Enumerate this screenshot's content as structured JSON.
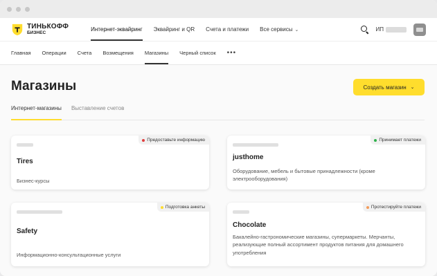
{
  "titlebar": {
    "dots": 3
  },
  "logo": {
    "line1": "ТИНЬКОФФ",
    "line2": "БИЗНЕС"
  },
  "topnav": {
    "items": [
      {
        "label": "Интернет-эквайринг",
        "active": true
      },
      {
        "label": "Эквайринг и QR",
        "active": false
      },
      {
        "label": "Счета и платежи",
        "active": false
      },
      {
        "label": "Все сервисы",
        "active": false
      }
    ],
    "user_prefix": "ИП"
  },
  "subnav": {
    "items": [
      {
        "label": "Главная",
        "active": false
      },
      {
        "label": "Операции",
        "active": false
      },
      {
        "label": "Счета",
        "active": false
      },
      {
        "label": "Возмещения",
        "active": false
      },
      {
        "label": "Магазины",
        "active": true
      },
      {
        "label": "Черный список",
        "active": false
      }
    ],
    "more_label": "•••"
  },
  "page": {
    "title": "Магазины",
    "create_button": "Создать магазин"
  },
  "tabs": [
    {
      "label": "Интернет-магазины",
      "active": true
    },
    {
      "label": "Выставление счетов",
      "active": false
    }
  ],
  "stores": [
    {
      "name": "Tires",
      "description": "Бизнес-курсы",
      "status": "Предоставьте информацию",
      "status_color": "#e03e3e"
    },
    {
      "name": "justhome",
      "description": "Оборудование, мебель и бытовые принадлежности (кроме электрооборудования)",
      "status": "Принимает платежи",
      "status_color": "#2fb24c"
    },
    {
      "name": "Safety",
      "description": "Информационно-консультационные услуги",
      "status": "Подготовка анкеты",
      "status_color": "#ffdd2d"
    },
    {
      "name": "Chocolate",
      "description": "Бакалейно-гастрономические магазины, супермаркеты. Мерчанты, реализующие полный ассортимент продуктов питания для домашнего употребления",
      "status": "Протестируйте платежи",
      "status_color": "#f39b5a"
    }
  ],
  "colors": {
    "accent": "#ffdd2d",
    "background": "#fafafa"
  }
}
